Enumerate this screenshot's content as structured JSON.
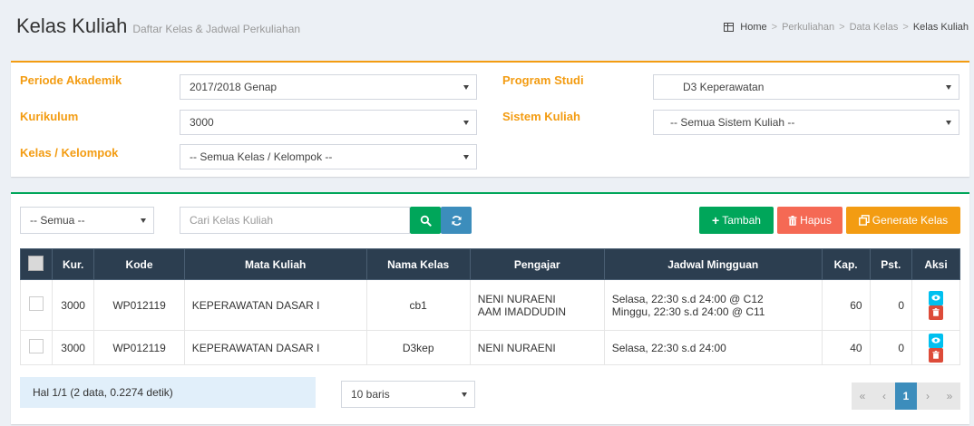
{
  "header": {
    "title": "Kelas Kuliah",
    "subtitle": "Daftar Kelas & Jadwal Perkuliahan",
    "breadcrumb": [
      "Home",
      "Perkuliahan",
      "Data Kelas",
      "Kelas Kuliah"
    ]
  },
  "filters": {
    "periode_label": "Periode Akademik",
    "periode_value": "2017/2018 Genap",
    "kurikulum_label": "Kurikulum",
    "kurikulum_value": "3000",
    "kelas_label": "Kelas / Kelompok",
    "kelas_value": "-- Semua Kelas / Kelompok --",
    "prodi_label": "Program Studi",
    "prodi_value": "D3 Keperawatan",
    "sistem_label": "Sistem Kuliah",
    "sistem_value": "-- Semua Sistem Kuliah --"
  },
  "toolbar": {
    "semua_value": "-- Semua --",
    "search_placeholder": "Cari Kelas Kuliah",
    "tambah_label": "Tambah",
    "hapus_label": "Hapus",
    "generate_label": "Generate Kelas"
  },
  "table": {
    "columns": [
      "Kur.",
      "Kode",
      "Mata Kuliah",
      "Nama Kelas",
      "Pengajar",
      "Jadwal Mingguan",
      "Kap.",
      "Pst.",
      "Aksi"
    ],
    "rows": [
      {
        "kur": "3000",
        "kode": "WP012119",
        "mk": "KEPERAWATAN DASAR I",
        "kelas": "cb1",
        "pengajar": [
          "NENI NURAENI",
          "AAM IMADDUDIN"
        ],
        "jadwal": [
          "Selasa, 22:30 s.d 24:00 @ C12",
          "Minggu, 22:30 s.d 24:00 @ C11"
        ],
        "kap": "60",
        "pst": "0"
      },
      {
        "kur": "3000",
        "kode": "WP012119",
        "mk": "KEPERAWATAN DASAR I",
        "kelas": "D3kep",
        "pengajar": [
          "NENI NURAENI"
        ],
        "jadwal": [
          "Selasa, 22:30 s.d 24:00"
        ],
        "kap": "40",
        "pst": "0"
      }
    ]
  },
  "footer": {
    "info": "Hal 1/1 (2 data, 0.2274 detik)",
    "page_size": "10 baris",
    "pager": [
      "«",
      "‹",
      "1",
      "›",
      "»"
    ]
  },
  "colors": {
    "orange": "#f39c12",
    "green": "#00a65a",
    "header_dark": "#2c3e50",
    "blue": "#3c8dbc",
    "red": "#f56954"
  }
}
